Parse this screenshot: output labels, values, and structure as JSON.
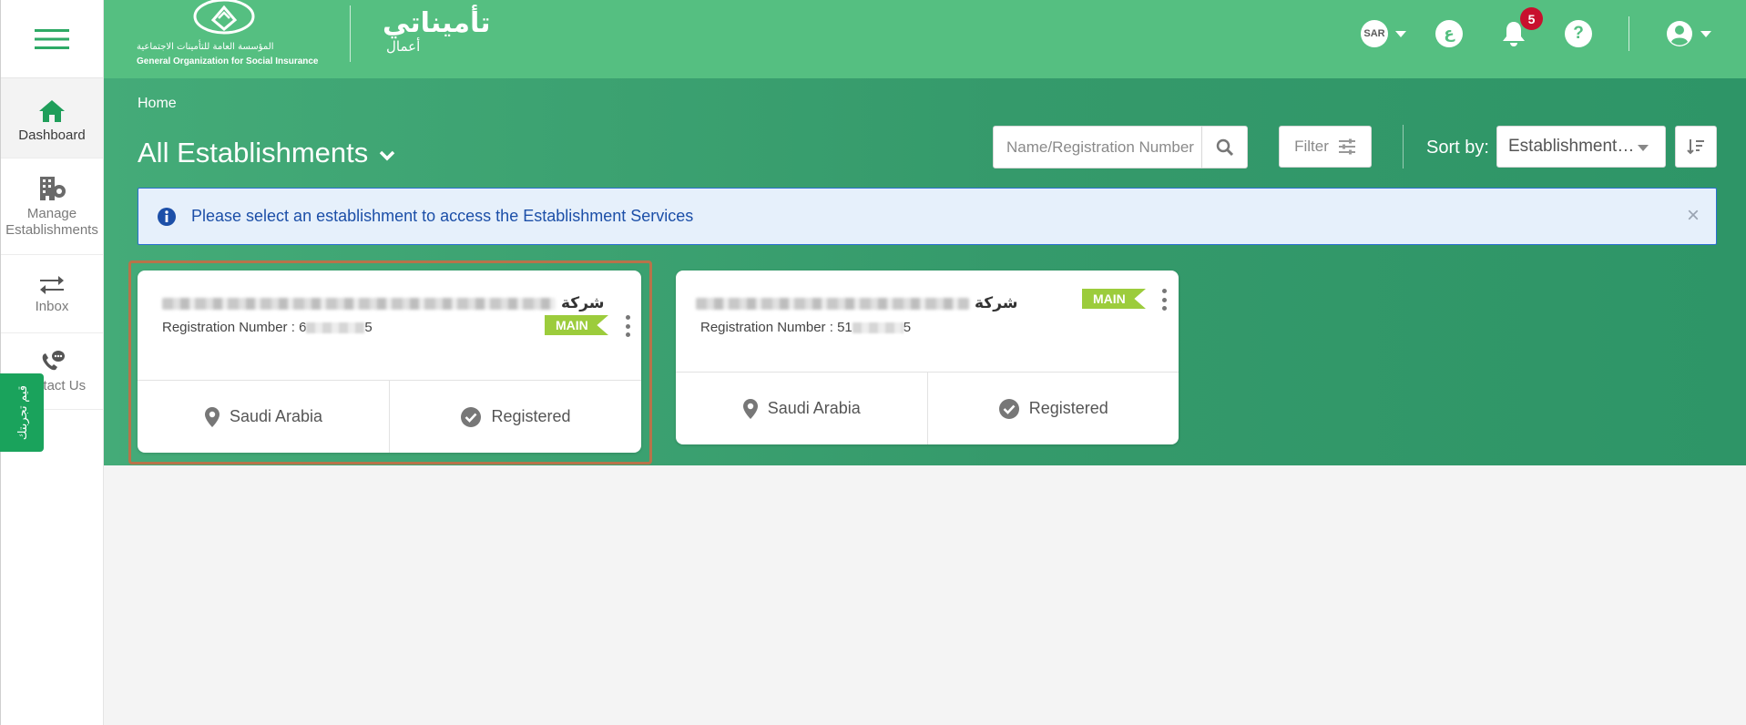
{
  "sidebar": {
    "items": [
      {
        "label": "Dashboard",
        "icon": "home-icon"
      },
      {
        "label": "Manage Establishments",
        "icon": "building-settings-icon"
      },
      {
        "label": "Inbox",
        "icon": "transfer-arrows-icon"
      },
      {
        "label": "Contact Us",
        "icon": "phone-chat-icon"
      }
    ],
    "feedback_tab": "قيم تجربتك"
  },
  "header": {
    "org_name_ar": "المؤسسة العامة للتأمينات الاجتماعية",
    "org_name_en": "General Organization for Social Insurance",
    "app_name_ar": "تأميناتي",
    "app_sub_ar": "أعمال",
    "currency": "SAR",
    "language_toggle": "ع",
    "notification_count": "5",
    "help_icon": "question-circle-icon",
    "user_icon": "user-circle-icon"
  },
  "page": {
    "breadcrumb": "Home",
    "title": "All Establishments",
    "search_placeholder": "Name/Registration Number",
    "filter_label": "Filter",
    "sort_label": "Sort by:",
    "sort_value": "Establishment Name"
  },
  "alert": {
    "message": "Please select an establishment to access the Establishment Services",
    "close": "×"
  },
  "establishments": [
    {
      "name": "شركة",
      "registration_label": "Registration Number :",
      "registration_prefix": "6",
      "registration_suffix": "5",
      "badge": "MAIN",
      "country": "Saudi Arabia",
      "status": "Registered"
    },
    {
      "name": "شركة",
      "registration_label": "Registration Number :",
      "registration_prefix": "51",
      "registration_suffix": "5",
      "badge": "MAIN",
      "country": "Saudi Arabia",
      "status": "Registered"
    }
  ],
  "colors": {
    "topbar": "#55bf81",
    "header_start": "#44ab78",
    "header_end": "#2e9567",
    "badge": "#9ccc3c",
    "alert_border": "#2a6fd1",
    "notification_badge": "#c8102e",
    "selection_outline": "#b8734a"
  }
}
